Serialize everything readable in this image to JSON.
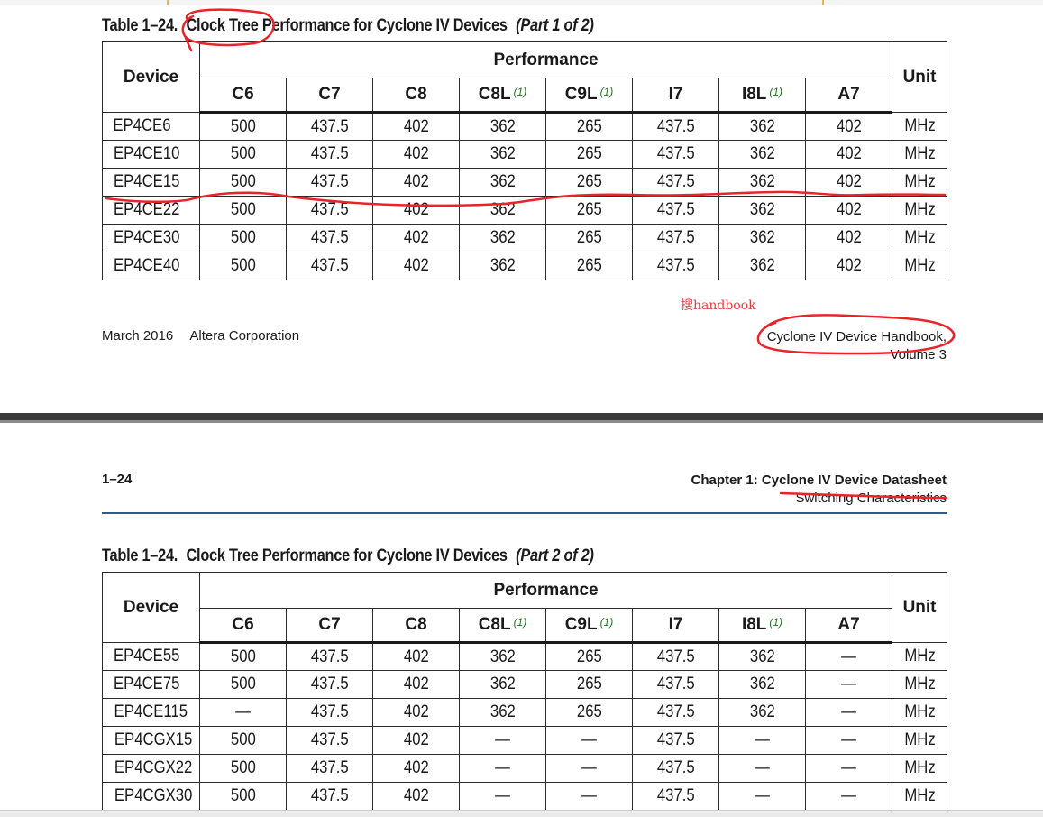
{
  "table_part1": {
    "number": "Table 1–24.",
    "title": "Clock Tree Performance for Cyclone IV Devices",
    "part": "(Part 1 of 2)",
    "head": {
      "device": "Device",
      "performance": "Performance",
      "unit": "Unit"
    },
    "grades": [
      {
        "label": "C6",
        "note": ""
      },
      {
        "label": "C7",
        "note": ""
      },
      {
        "label": "C8",
        "note": ""
      },
      {
        "label": "C8L",
        "note": "(1)"
      },
      {
        "label": "C9L",
        "note": "(1)"
      },
      {
        "label": "I7",
        "note": ""
      },
      {
        "label": "I8L",
        "note": "(1)"
      },
      {
        "label": "A7",
        "note": ""
      }
    ],
    "rows": [
      {
        "device": "EP4CE6",
        "values": [
          "500",
          "437.5",
          "402",
          "362",
          "265",
          "437.5",
          "362",
          "402"
        ],
        "unit": "MHz"
      },
      {
        "device": "EP4CE10",
        "values": [
          "500",
          "437.5",
          "402",
          "362",
          "265",
          "437.5",
          "362",
          "402"
        ],
        "unit": "MHz"
      },
      {
        "device": "EP4CE15",
        "values": [
          "500",
          "437.5",
          "402",
          "362",
          "265",
          "437.5",
          "362",
          "402"
        ],
        "unit": "MHz"
      },
      {
        "device": "EP4CE22",
        "values": [
          "500",
          "437.5",
          "402",
          "362",
          "265",
          "437.5",
          "362",
          "402"
        ],
        "unit": "MHz"
      },
      {
        "device": "EP4CE30",
        "values": [
          "500",
          "437.5",
          "402",
          "362",
          "265",
          "437.5",
          "362",
          "402"
        ],
        "unit": "MHz"
      },
      {
        "device": "EP4CE40",
        "values": [
          "500",
          "437.5",
          "402",
          "362",
          "265",
          "437.5",
          "362",
          "402"
        ],
        "unit": "MHz"
      }
    ]
  },
  "watermark": "搜handbook",
  "footer": {
    "date": "March 2016",
    "company": "Altera Corporation",
    "handbook": "Cyclone IV Device Handbook,",
    "volume": "Volume 3"
  },
  "page2_header": {
    "page_number": "1–24",
    "chapter": "Chapter 1:  Cyclone IV Device Datasheet",
    "section": "Switching Characteristics"
  },
  "table_part2": {
    "number": "Table 1–24.",
    "title": "Clock Tree Performance for Cyclone IV Devices",
    "part": "(Part 2 of 2)",
    "head": {
      "device": "Device",
      "performance": "Performance",
      "unit": "Unit"
    },
    "grades": [
      {
        "label": "C6",
        "note": ""
      },
      {
        "label": "C7",
        "note": ""
      },
      {
        "label": "C8",
        "note": ""
      },
      {
        "label": "C8L",
        "note": "(1)"
      },
      {
        "label": "C9L",
        "note": "(1)"
      },
      {
        "label": "I7",
        "note": ""
      },
      {
        "label": "I8L",
        "note": "(1)"
      },
      {
        "label": "A7",
        "note": ""
      }
    ],
    "rows": [
      {
        "device": "EP4CE55",
        "values": [
          "500",
          "437.5",
          "402",
          "362",
          "265",
          "437.5",
          "362",
          "—"
        ],
        "unit": "MHz"
      },
      {
        "device": "EP4CE75",
        "values": [
          "500",
          "437.5",
          "402",
          "362",
          "265",
          "437.5",
          "362",
          "—"
        ],
        "unit": "MHz"
      },
      {
        "device": "EP4CE115",
        "values": [
          "—",
          "437.5",
          "402",
          "362",
          "265",
          "437.5",
          "362",
          "—"
        ],
        "unit": "MHz"
      },
      {
        "device": "EP4CGX15",
        "values": [
          "500",
          "437.5",
          "402",
          "—",
          "—",
          "437.5",
          "—",
          "—"
        ],
        "unit": "MHz"
      },
      {
        "device": "EP4CGX22",
        "values": [
          "500",
          "437.5",
          "402",
          "—",
          "—",
          "437.5",
          "—",
          "—"
        ],
        "unit": "MHz"
      },
      {
        "device": "EP4CGX30",
        "values": [
          "500",
          "437.5",
          "402",
          "—",
          "—",
          "437.5",
          "—",
          "—"
        ],
        "unit": "MHz"
      }
    ]
  },
  "colors": {
    "annotation": "#e8242a",
    "rule": "#2c5c88",
    "note": "#1a7a1a"
  }
}
